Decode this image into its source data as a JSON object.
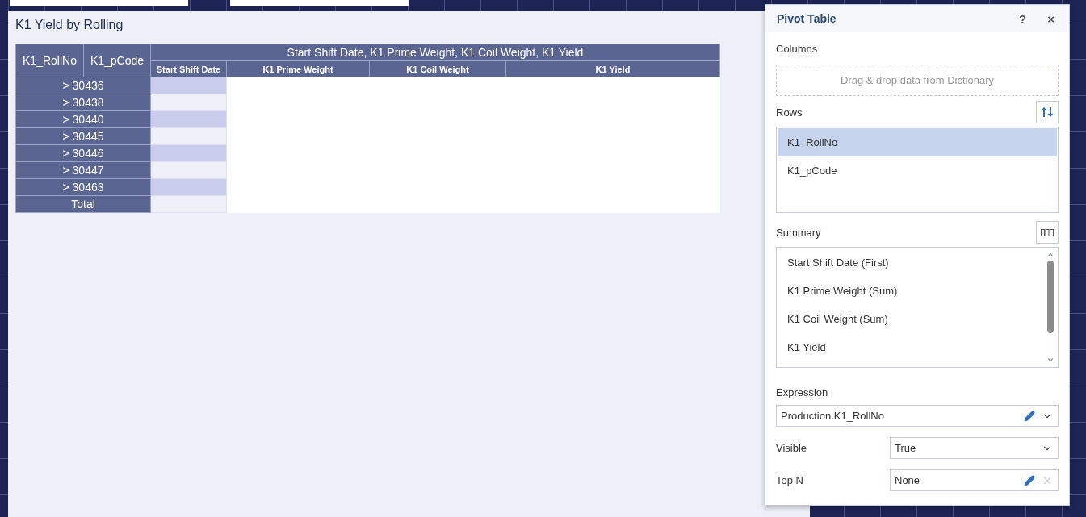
{
  "report": {
    "title": "K1 Yield by Rolling",
    "table": {
      "row_headers": [
        "K1_RollNo",
        "K1_pCode"
      ],
      "group_header": "Start Shift Date, K1 Prime Weight, K1 Coil Weight, K1 Yield",
      "columns": [
        "Start Shift Date",
        "K1 Prime Weight",
        "K1 Coil Weight",
        "K1 Yield"
      ],
      "rows": [
        {
          "label": "> 30436"
        },
        {
          "label": "> 30438"
        },
        {
          "label": "> 30440"
        },
        {
          "label": "> 30445"
        },
        {
          "label": "> 30446"
        },
        {
          "label": "> 30447"
        },
        {
          "label": "> 30463"
        },
        {
          "label": "Total"
        }
      ]
    }
  },
  "pivot_panel": {
    "title": "Pivot Table",
    "help": "?",
    "close": "×",
    "columns": {
      "label": "Columns",
      "placeholder": "Drag & drop data from Dictionary"
    },
    "rows": {
      "label": "Rows",
      "items": [
        {
          "label": "K1_RollNo",
          "selected": true
        },
        {
          "label": "K1_pCode",
          "selected": false
        }
      ]
    },
    "summary": {
      "label": "Summary",
      "items": [
        "Start Shift Date (First)",
        "K1 Prime Weight (Sum)",
        "K1 Coil Weight (Sum)",
        "K1 Yield"
      ]
    },
    "expression": {
      "label": "Expression",
      "value": "Production.K1_RollNo"
    },
    "visible": {
      "label": "Visible",
      "value": "True"
    },
    "top_n": {
      "label": "Top N",
      "value": "None"
    }
  }
}
